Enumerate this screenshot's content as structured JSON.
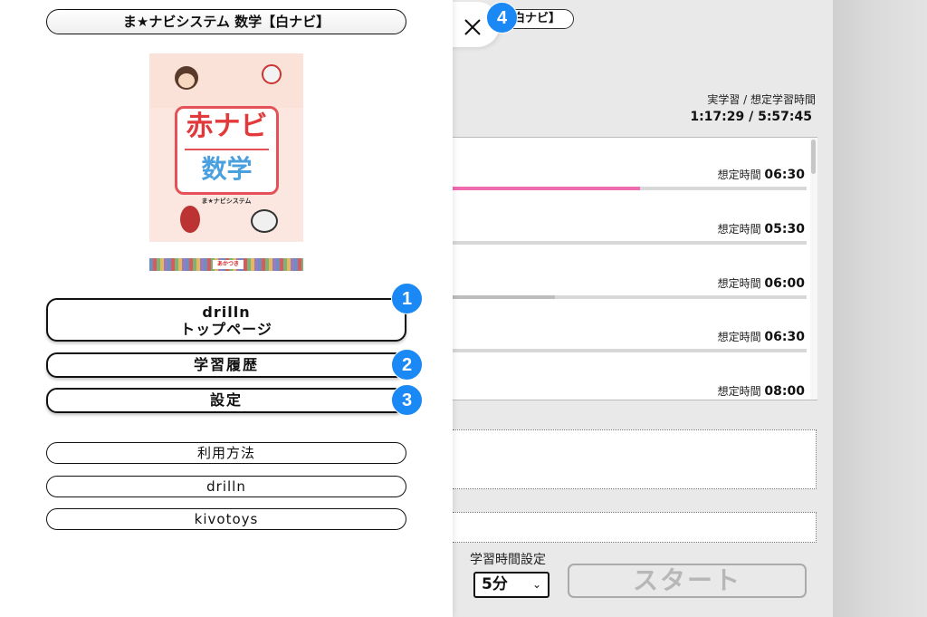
{
  "app": {
    "header_pill": "白ナビ】"
  },
  "summary": {
    "label": "実学習 / 想定学習時間",
    "value": "1:17:29 / 5:57:45"
  },
  "list": {
    "time_prefix": "想定時間",
    "rows": [
      {
        "time": "06:30",
        "progress": 0.53,
        "color": "#f06ab0"
      },
      {
        "time": "05:30",
        "progress": 0.0,
        "color": "#bdbdbd"
      },
      {
        "time": "06:00",
        "progress": 0.29,
        "color": "#bdbdbd"
      },
      {
        "time": "06:30",
        "progress": 0.0,
        "color": "#bdbdbd"
      },
      {
        "time": "08:00",
        "progress": 0.0,
        "color": "#bdbdbd"
      }
    ]
  },
  "study": {
    "label": "学習時間設定",
    "selected": "5分",
    "start_label": "スタート"
  },
  "drawer": {
    "title": "ま★ナビシステム 数学【白ナビ】",
    "cover": {
      "title_main": "赤ナビ",
      "title_sub": "数学",
      "system": "ま★ナビシステム",
      "publisher": "あかつき"
    },
    "nav": {
      "top_line1": "drilln",
      "top_line2": "トップページ",
      "history": "学習履歴",
      "settings": "設定"
    },
    "links": {
      "usage": "利用方法",
      "drilln": "drilln",
      "kivotoys": "kivotoys"
    }
  },
  "badges": {
    "b1": "1",
    "b2": "2",
    "b3": "3",
    "b4": "4"
  },
  "colors": {
    "accent": "#1a88f5",
    "progress_pink": "#f06ab0",
    "cover_red": "#e23a3a",
    "cover_blue": "#4aa0de"
  }
}
